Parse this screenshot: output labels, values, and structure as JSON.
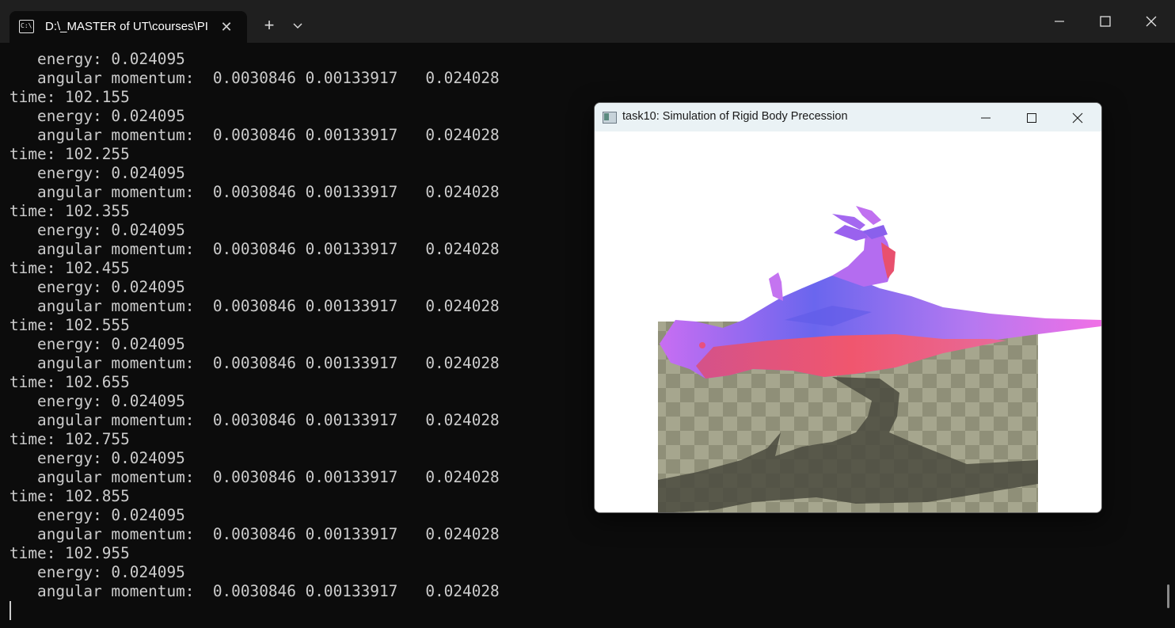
{
  "terminal": {
    "tab_title": "D:\\_MASTER of UT\\courses\\PI",
    "close_tab_glyph": "✕",
    "new_tab_glyph": "+",
    "icons": [
      "terminal-icon",
      "close-icon",
      "plus-icon",
      "chevron-down-icon",
      "minimize-icon",
      "maximize-icon",
      "close-icon"
    ],
    "lines": [
      "   energy: 0.024095",
      "   angular momentum:  0.0030846 0.00133917   0.024028",
      "time: 102.155",
      "   energy: 0.024095",
      "   angular momentum:  0.0030846 0.00133917   0.024028",
      "time: 102.255",
      "   energy: 0.024095",
      "   angular momentum:  0.0030846 0.00133917   0.024028",
      "time: 102.355",
      "   energy: 0.024095",
      "   angular momentum:  0.0030846 0.00133917   0.024028",
      "time: 102.455",
      "   energy: 0.024095",
      "   angular momentum:  0.0030846 0.00133917   0.024028",
      "time: 102.555",
      "   energy: 0.024095",
      "   angular momentum:  0.0030846 0.00133917   0.024028",
      "time: 102.655",
      "   energy: 0.024095",
      "   angular momentum:  0.0030846 0.00133917   0.024028",
      "time: 102.755",
      "   energy: 0.024095",
      "   angular momentum:  0.0030846 0.00133917   0.024028",
      "time: 102.855",
      "   energy: 0.024095",
      "   angular momentum:  0.0030846 0.00133917   0.024028",
      "time: 102.955",
      "   energy: 0.024095",
      "   angular momentum:  0.0030846 0.00133917   0.024028"
    ]
  },
  "sim_window": {
    "title": "task10: Simulation of Rigid Body Precession",
    "icons": [
      "app-icon",
      "minimize-icon",
      "maximize-icon",
      "close-icon"
    ]
  },
  "colors": {
    "terminal_bg": "#0c0c0c",
    "text": "#cccccc",
    "checker_light": "#a6a68e",
    "checker_dark": "#8f8f78",
    "body_top": "#6f6cf0",
    "body_side": "#e85a80"
  }
}
